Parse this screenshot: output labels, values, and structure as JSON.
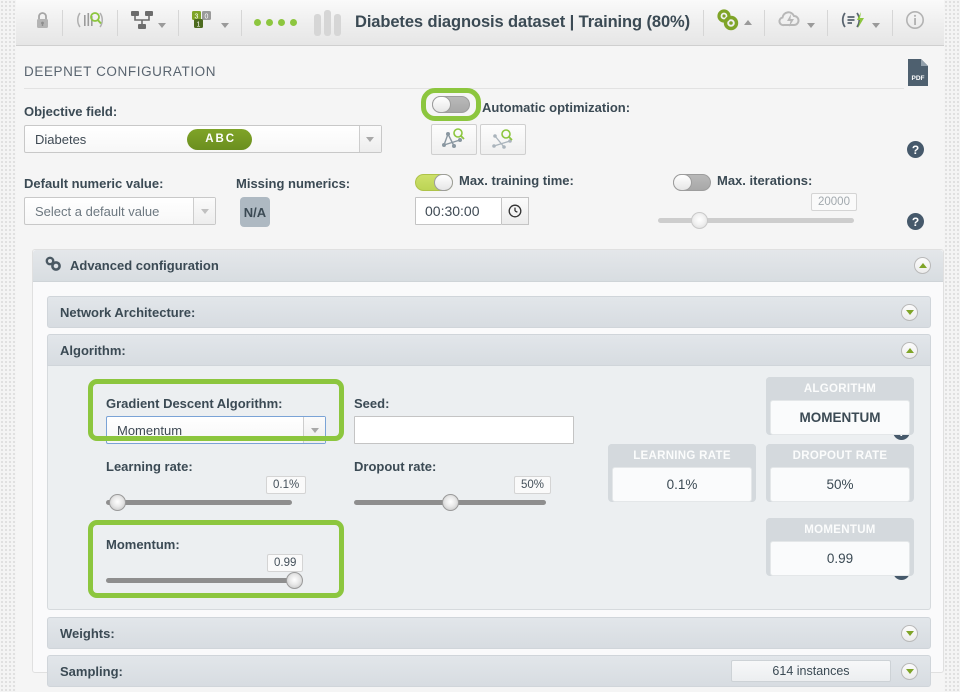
{
  "header": {
    "title": "Diabetes diagnosis dataset | Training (80%)",
    "icons": {
      "lock": "lock-icon",
      "search_signal": "signal-search-icon",
      "network": "network-icon",
      "batch": "batch-numbers-icon",
      "dots": "status-dots-icon",
      "bars": "bars-icon",
      "gears": "gears-icon",
      "cloud": "cloud-flash-icon",
      "script": "script-flash-icon",
      "info": "info-icon"
    }
  },
  "panel": {
    "title": "DEEPNET CONFIGURATION",
    "pdf_icon_label": "PDF"
  },
  "objective": {
    "label": "Objective field:",
    "value": "Diabetes",
    "badge": "ABC"
  },
  "automatic_optimization": {
    "label": "Automatic optimization:",
    "toggle_on": false,
    "button1": "auto-network-search-icon",
    "button2": "auto-structure-search-icon"
  },
  "default_numeric": {
    "label": "Default numeric value:",
    "placeholder": "Select a default value"
  },
  "missing_numerics": {
    "label": "Missing numerics:",
    "badge": "N/A"
  },
  "max_training_time": {
    "label": "Max. training time:",
    "toggle_on": true,
    "value": "00:30:00"
  },
  "max_iterations": {
    "label": "Max. iterations:",
    "toggle_on": false,
    "value": "20000"
  },
  "advanced": {
    "title": "Advanced configuration",
    "sections": [
      {
        "title": "Network Architecture:",
        "expanded": false
      },
      {
        "title": "Algorithm:",
        "expanded": true
      },
      {
        "title": "Weights:",
        "expanded": false
      },
      {
        "title": "Sampling:",
        "expanded": false,
        "badge": "614 instances"
      }
    ]
  },
  "algorithm": {
    "gradient_descent": {
      "label": "Gradient Descent Algorithm:",
      "value": "Momentum"
    },
    "seed": {
      "label": "Seed:",
      "value": ""
    },
    "learning_rate": {
      "label": "Learning rate:",
      "value": "0.1%",
      "knob_pct": 2
    },
    "dropout_rate": {
      "label": "Dropout rate:",
      "value": "50%",
      "knob_pct": 50
    },
    "momentum": {
      "label": "Momentum:",
      "value": "0.99",
      "knob_pct": 98
    },
    "cards": [
      {
        "caption": "ALGORITHM",
        "value": "MOMENTUM"
      },
      {
        "caption": "LEARNING RATE",
        "value": "0.1%"
      },
      {
        "caption": "DROPOUT RATE",
        "value": "50%"
      },
      {
        "caption": "MOMENTUM",
        "value": "0.99"
      }
    ]
  },
  "colors": {
    "accent_green": "#8cc63e",
    "badge_green": "#7fa428",
    "text_dark": "#3b4a54",
    "help_badge": "#46596b"
  }
}
